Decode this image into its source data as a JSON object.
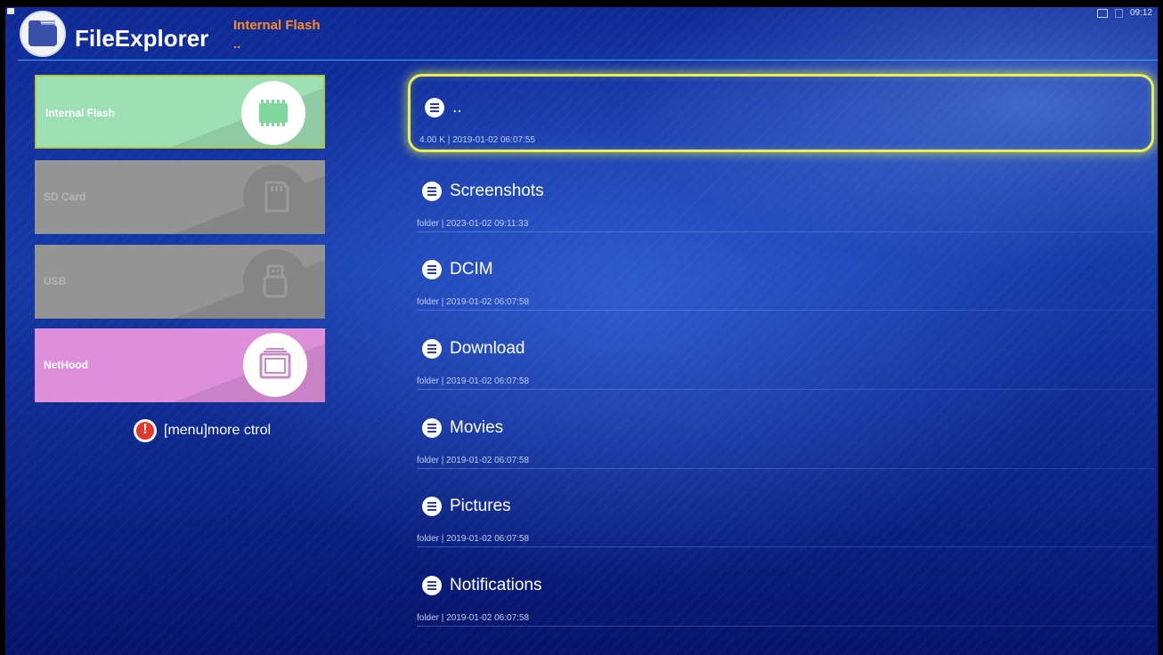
{
  "status_bar": {
    "time": "09:12"
  },
  "header": {
    "app_title": "FileExplorer",
    "current_location": "Internal Flash",
    "current_path": ".."
  },
  "sidebar": {
    "items": [
      {
        "label": "Internal Flash",
        "icon": "memory-chip-icon",
        "color": "#9de0b3",
        "state": "selected"
      },
      {
        "label": "SD Card",
        "icon": "sd-card-icon",
        "color": "#949494",
        "state": "disabled"
      },
      {
        "label": "USB",
        "icon": "usb-drive-icon",
        "color": "#949494",
        "state": "disabled"
      },
      {
        "label": "NetHood",
        "icon": "network-windows-icon",
        "color": "#dd8fd9",
        "state": "enabled"
      }
    ],
    "menu_hint": "[menu]more ctrol"
  },
  "files": [
    {
      "name": "..",
      "meta": "4.00 K | 2019-01-02 06:07:55",
      "selected": true
    },
    {
      "name": "Screenshots",
      "meta": "folder | 2023-01-02 09:11:33"
    },
    {
      "name": "DCIM",
      "meta": "folder | 2019-01-02 06:07:58"
    },
    {
      "name": "Download",
      "meta": "folder | 2019-01-02 06:07:58"
    },
    {
      "name": "Movies",
      "meta": "folder | 2019-01-02 06:07:58"
    },
    {
      "name": "Pictures",
      "meta": "folder | 2019-01-02 06:07:58"
    },
    {
      "name": "Notifications",
      "meta": "folder | 2019-01-02 06:07:58"
    }
  ],
  "colors": {
    "accent_path": "#ff8a1e",
    "selection_outline": "#e9ef52",
    "header_rule": "#3aa6f0"
  }
}
